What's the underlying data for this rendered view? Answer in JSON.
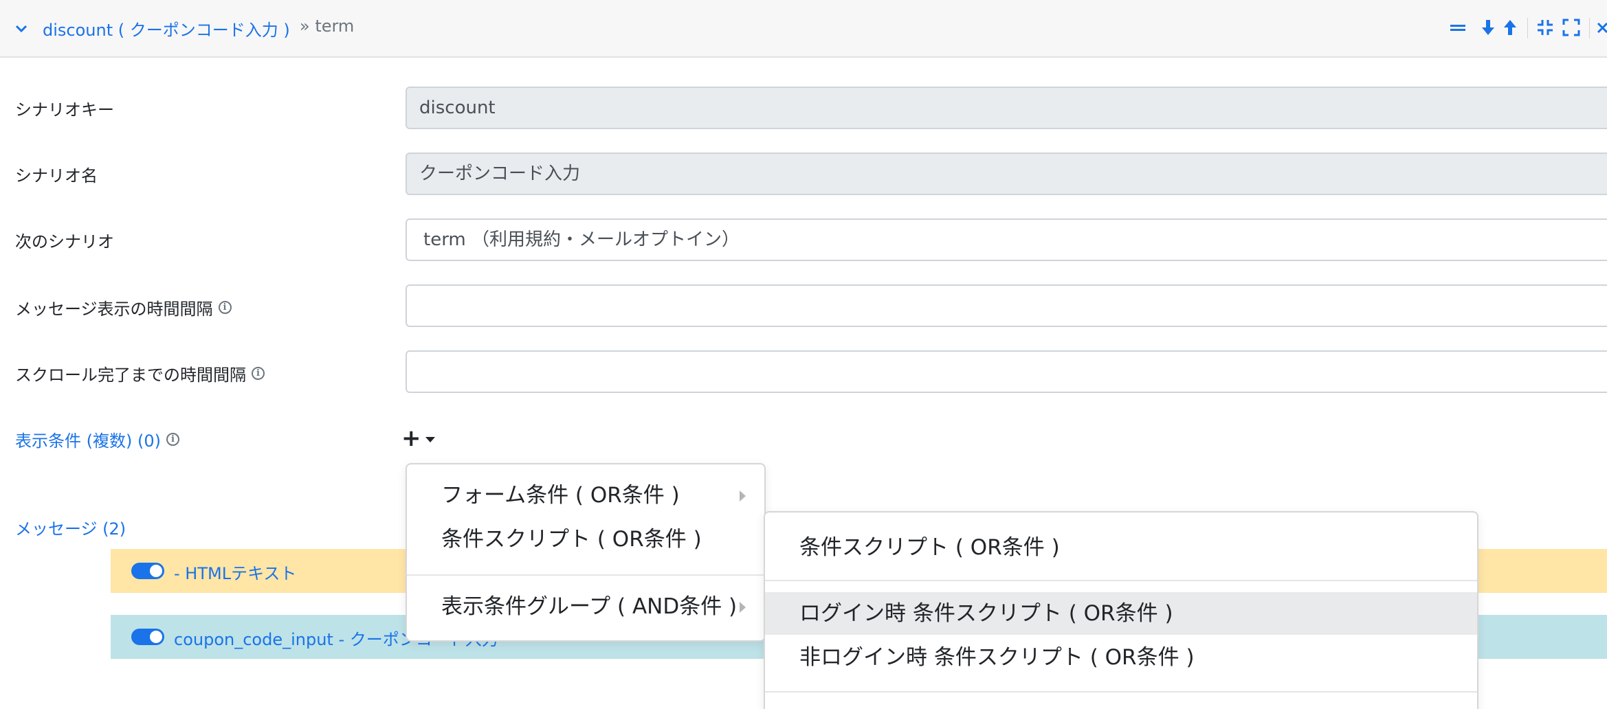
{
  "header": {
    "title": "discount ( クーポンコード入力 )",
    "breadcrumb": "» term"
  },
  "form": {
    "scenario_key": {
      "label": "シナリオキー",
      "value": "discount"
    },
    "scenario_name": {
      "label": "シナリオ名",
      "value": "クーポンコード入力"
    },
    "next_scenario": {
      "label": "次のシナリオ",
      "value": "term （利用規約・メールオプトイン）"
    },
    "message_interval": {
      "label": "メッセージ表示の時間間隔",
      "value": ""
    },
    "scroll_interval": {
      "label": "スクロール完了までの時間間隔",
      "value": ""
    },
    "display_conditions": {
      "label": "表示条件 (複数) (0)",
      "add_button": "+"
    }
  },
  "messages": {
    "label": "メッセージ (2)",
    "items": [
      {
        "text": "- HTMLテキスト",
        "enabled": true,
        "color": "#ffe5a6"
      },
      {
        "text": "coupon_code_input - クーポンコード入力",
        "enabled": true,
        "color": "#bde2e8"
      }
    ]
  },
  "menu": {
    "items": [
      "フォーム条件 ( OR条件 )",
      "条件スクリプト ( OR条件 )",
      "表示条件グループ ( AND条件 )"
    ]
  },
  "submenu": {
    "items": [
      "条件スクリプト ( OR条件 )",
      "ログイン時 条件スクリプト ( OR条件 )",
      "非ログイン時 条件スクリプト ( OR条件 )"
    ]
  },
  "icons": {
    "info": "i",
    "accent_color": "#1a73e8"
  }
}
